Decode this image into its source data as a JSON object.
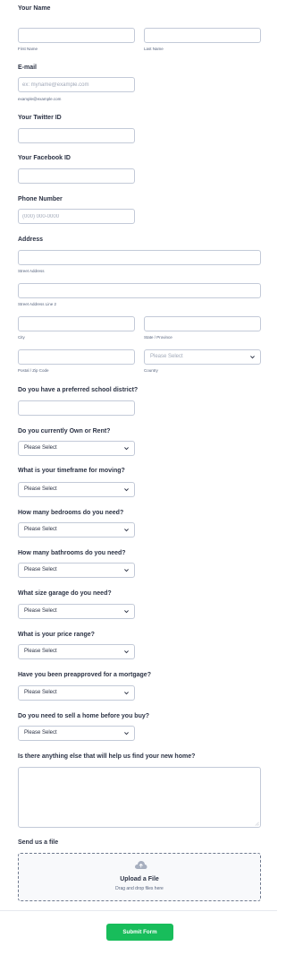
{
  "name": {
    "label": "Your Name",
    "first_sub": "First Name",
    "last_sub": "Last Name"
  },
  "email": {
    "label": "E-mail",
    "placeholder": "ex: myname@example.com",
    "sub": "example@example.com"
  },
  "twitter": {
    "label": "Your Twitter ID"
  },
  "facebook": {
    "label": "Your Facebook ID"
  },
  "phone": {
    "label": "Phone Number",
    "placeholder": "(000) 000-0000"
  },
  "address": {
    "label": "Address",
    "street_sub": "Street Address",
    "street2_sub": "Street Address Line 2",
    "city_sub": "City",
    "state_sub": "State / Province",
    "zip_sub": "Postal / Zip Code",
    "country_sub": "Country",
    "country_value": "Please Select"
  },
  "school": {
    "label": "Do you have a preferred school district?"
  },
  "own_rent": {
    "label": "Do you currently Own or Rent?",
    "value": "Please Select"
  },
  "timeframe": {
    "label": "What is your timeframe for moving?",
    "value": "Please Select"
  },
  "bedrooms": {
    "label": "How many bedrooms do you need?",
    "value": "Please Select"
  },
  "bathrooms": {
    "label": "How many bathrooms do you need?",
    "value": "Please Select"
  },
  "garage": {
    "label": "What size garage do you need?",
    "value": "Please Select"
  },
  "price": {
    "label": "What is your price range?",
    "value": "Please Select"
  },
  "preapproved": {
    "label": "Have you been preapproved for a mortgage?",
    "value": "Please Select"
  },
  "sell_first": {
    "label": "Do you need to sell a home before you buy?",
    "value": "Please Select"
  },
  "anything_else": {
    "label": "Is there anything else that will help us find your new home?"
  },
  "file": {
    "label": "Send us a file",
    "upload_title": "Upload a File",
    "upload_sub": "Drag and drop files here"
  },
  "submit_label": "Submit Form",
  "colors": {
    "accent": "#18bd5b",
    "text": "#2c3345",
    "border": "#c3cad8"
  }
}
